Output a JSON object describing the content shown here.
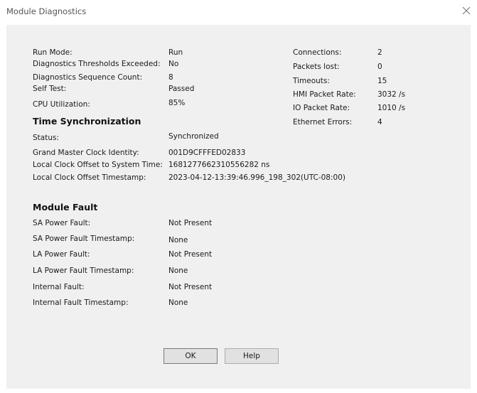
{
  "window": {
    "title": "Module Diagnostics"
  },
  "general": {
    "run_mode_label": "Run Mode:",
    "run_mode_value": "Run",
    "thresholds_label": "Diagnostics Thresholds Exceeded:",
    "thresholds_value": "No",
    "sequence_label": "Diagnostics Sequence Count:",
    "sequence_value": "8",
    "self_test_label": "Self Test:",
    "self_test_value": "Passed",
    "cpu_label": "CPU Utilization:",
    "cpu_value": "85%"
  },
  "network": {
    "connections_label": "Connections:",
    "connections_value": "2",
    "packets_lost_label": "Packets lost:",
    "packets_lost_value": "0",
    "timeouts_label": "Timeouts:",
    "timeouts_value": "15",
    "hmi_rate_label": "HMI Packet Rate:",
    "hmi_rate_value": "3032 /s",
    "io_rate_label": "IO Packet Rate:",
    "io_rate_value": "1010 /s",
    "ethernet_errors_label": "Ethernet Errors:",
    "ethernet_errors_value": "4"
  },
  "time_sync": {
    "heading": "Time Synchronization",
    "status_label": "Status:",
    "status_value": "Synchronized",
    "gm_label": "Grand Master Clock Identity:",
    "gm_value": "001D9CFFFED02833",
    "offset_label": "Local Clock Offset to System Time:",
    "offset_value": "1681277662310556282 ns",
    "offset_ts_label": "Local Clock Offset Timestamp:",
    "offset_ts_value": "2023-04-12-13:39:46.996_198_302(UTC-08:00)"
  },
  "module_fault": {
    "heading": "Module Fault",
    "sa_label": "SA Power Fault:",
    "sa_value": "Not Present",
    "sa_ts_label": "SA Power Fault Timestamp:",
    "sa_ts_value": "None",
    "la_label": "LA Power Fault:",
    "la_value": "Not Present",
    "la_ts_label": "LA Power Fault Timestamp:",
    "la_ts_value": "None",
    "internal_label": "Internal Fault:",
    "internal_value": "Not Present",
    "internal_ts_label": "Internal Fault Timestamp:",
    "internal_ts_value": "None"
  },
  "buttons": {
    "ok": "OK",
    "help": "Help"
  },
  "icons": {
    "close": "close-icon"
  }
}
